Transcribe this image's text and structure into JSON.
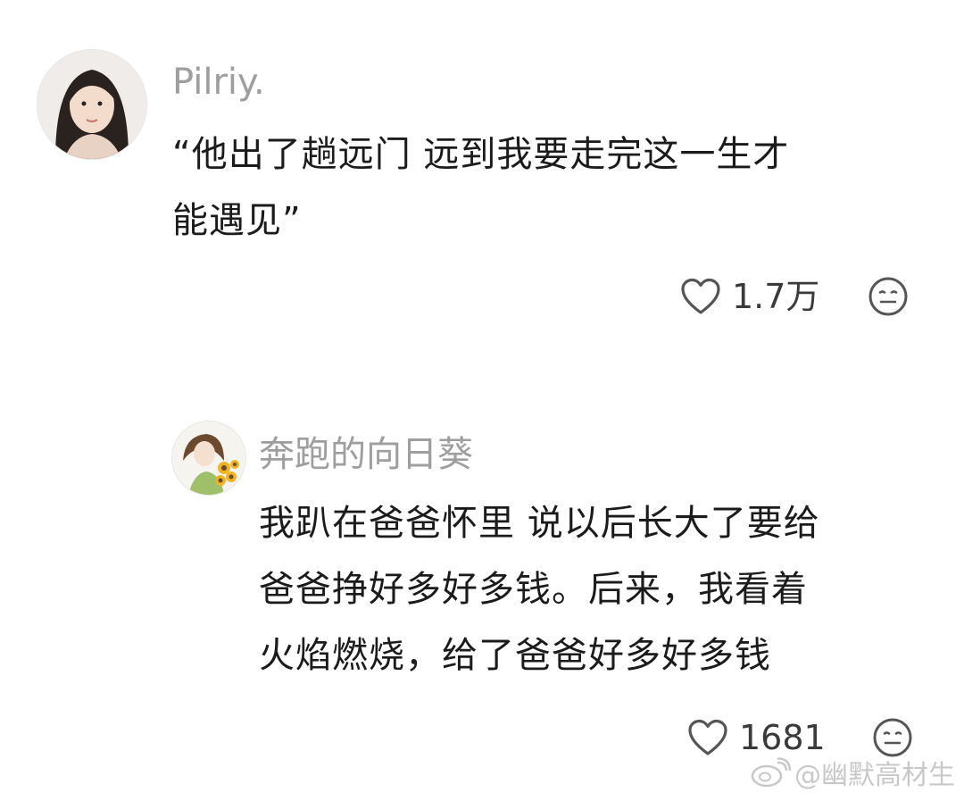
{
  "comments": [
    {
      "username": "Pilriy.",
      "avatar_icon": "avatar-girl-portrait",
      "text_lines": [
        "“他出了趟远门 远到我要走完这一生才",
        "能遇见”"
      ],
      "likes": "1.7万",
      "like_icon": "heart-outline-icon",
      "dislike_icon": "meh-face-icon"
    },
    {
      "username": "奔跑的向日葵",
      "avatar_icon": "avatar-girl-sunflowers",
      "text_lines": [
        "我趴在爸爸怀里 说以后长大了要给",
        "爸爸挣好多好多钱。后来，我看着",
        "火焰燃烧，给了爸爸好多好多钱"
      ],
      "likes": "1681",
      "like_icon": "heart-outline-icon",
      "dislike_icon": "meh-face-icon"
    }
  ],
  "watermark": {
    "text": "@幽默高材生",
    "icon": "weibo-logo-icon"
  },
  "colors": {
    "username": "#9e9e9e",
    "body": "#1b1b1b",
    "icon": "#555555",
    "watermark": "#c8c8c8"
  }
}
